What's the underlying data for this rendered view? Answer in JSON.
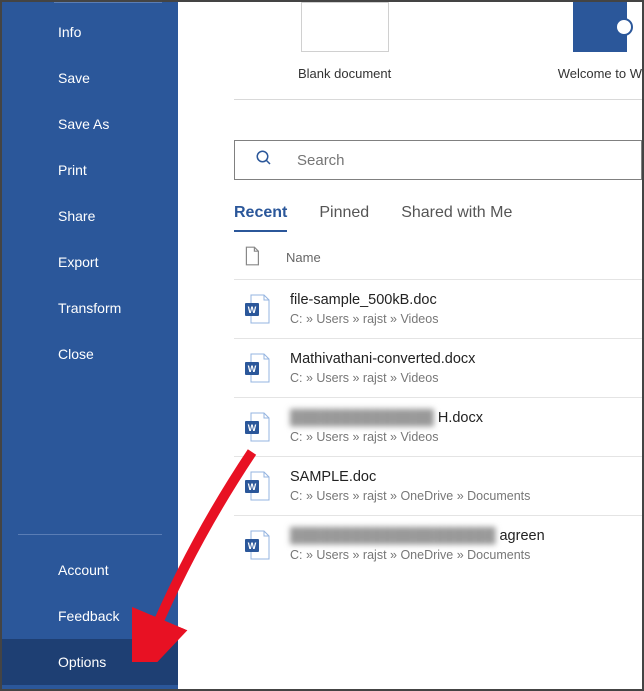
{
  "sidebar": {
    "items": [
      {
        "label": "Info"
      },
      {
        "label": "Save"
      },
      {
        "label": "Save As"
      },
      {
        "label": "Print"
      },
      {
        "label": "Share"
      },
      {
        "label": "Export"
      },
      {
        "label": "Transform"
      },
      {
        "label": "Close"
      }
    ],
    "bottom": [
      {
        "label": "Account"
      },
      {
        "label": "Feedback"
      },
      {
        "label": "Options",
        "active": true
      }
    ]
  },
  "templates": {
    "blank": "Blank document",
    "welcome": "Welcome to W"
  },
  "search": {
    "placeholder": "Search"
  },
  "tabs": {
    "recent": "Recent",
    "pinned": "Pinned",
    "shared": "Shared with Me"
  },
  "list_header": "Name",
  "files": [
    {
      "name": "file-sample_500kB.doc",
      "path": "C: » Users » rajst » Videos"
    },
    {
      "name": "Mathivathani-converted.docx",
      "path": "C: » Users » rajst » Videos"
    },
    {
      "name": "██████████████ H.docx",
      "path": "C: » Users » rajst » Videos",
      "redacted": true
    },
    {
      "name": "SAMPLE.doc",
      "path": "C: » Users » rajst » OneDrive » Documents"
    },
    {
      "name": "████████████████████ agreen",
      "path": "C: » Users » rajst » OneDrive » Documents",
      "redacted": true
    }
  ]
}
